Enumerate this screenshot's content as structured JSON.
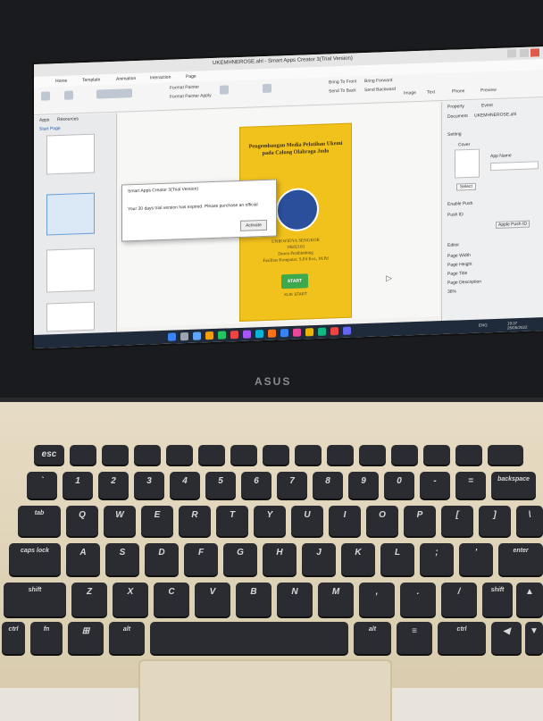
{
  "app": {
    "window_title": "UKEMHNEROSE.ahl - Smart Apps Creator 3(Trial Version)",
    "tabs": [
      "Home",
      "Template",
      "Animation",
      "Interaction",
      "Page"
    ],
    "ribbon": {
      "format_painter": "Format Painter",
      "format_painter_apply": "Format Painter Apply",
      "bring_to_front": "Bring To Front",
      "bring_forward": "Bring Forward",
      "send_to_back": "Send To Back",
      "send_backward": "Send Backward",
      "image": "Image",
      "text": "Text",
      "phone": "Phone",
      "preview": "Preview"
    },
    "left_panel": {
      "tab_app": "Apps",
      "tab_resources": "Resources",
      "section": "Start Page"
    },
    "right_panel": {
      "tab_property": "Property",
      "tab_event": "Event",
      "document_label": "Document",
      "document_value": "UKEMHNEROSE.ahl",
      "setting": "Setting",
      "cover": "Cover",
      "app_name": "App Name",
      "select": "Select",
      "disable_push": "Enable Push",
      "push_id": "Push ID",
      "apple_push_id": "Apple Push ID",
      "editor": "Editor",
      "page_width": "Page Width",
      "page_height": "Page Height",
      "page_title": "Page Title",
      "page_description": "Page Description"
    },
    "zoom": "36%"
  },
  "dialog": {
    "title": "Smart Apps Creator 3(Trial Version)",
    "message": "Your 30 days trial version has expired. Please purchase an official",
    "button": "Activate"
  },
  "phone_page": {
    "heading": "Pengembangan Media Pelatihan Ukemi pada Calong Olahraga Judo",
    "university": "UNIKWIDYA SENGKOR",
    "number": "18602103",
    "advisor": "Dosen Pembimbing",
    "advisor_name": "Fasilitas Komputer, S.Pd Kor., M.Pd",
    "start": "START",
    "click": "KLIK START"
  },
  "taskbar": {
    "lang": "ENG",
    "time": "19:37",
    "date": "26/05/2022"
  },
  "brand": "ASUS",
  "keyboard": {
    "row1": [
      "esc",
      "",
      "",
      "",
      "",
      "",
      "",
      "",
      "",
      "",
      "",
      "",
      "",
      "",
      ""
    ],
    "row2": [
      "`",
      "1",
      "2",
      "3",
      "4",
      "5",
      "6",
      "7",
      "8",
      "9",
      "0",
      "-",
      "=",
      "backspace"
    ],
    "row3": [
      "tab",
      "Q",
      "W",
      "E",
      "R",
      "T",
      "Y",
      "U",
      "I",
      "O",
      "P",
      "[",
      "]",
      "\\"
    ],
    "row4": [
      "caps lock",
      "A",
      "S",
      "D",
      "F",
      "G",
      "H",
      "J",
      "K",
      "L",
      ";",
      "'",
      "enter"
    ],
    "row5": [
      "shift",
      "Z",
      "X",
      "C",
      "V",
      "B",
      "N",
      "M",
      ",",
      ".",
      "/",
      "shift",
      "▲"
    ],
    "row6": [
      "ctrl",
      "fn",
      "⊞",
      "alt",
      "",
      "alt",
      "≡",
      "ctrl",
      "◀",
      "▼"
    ]
  }
}
